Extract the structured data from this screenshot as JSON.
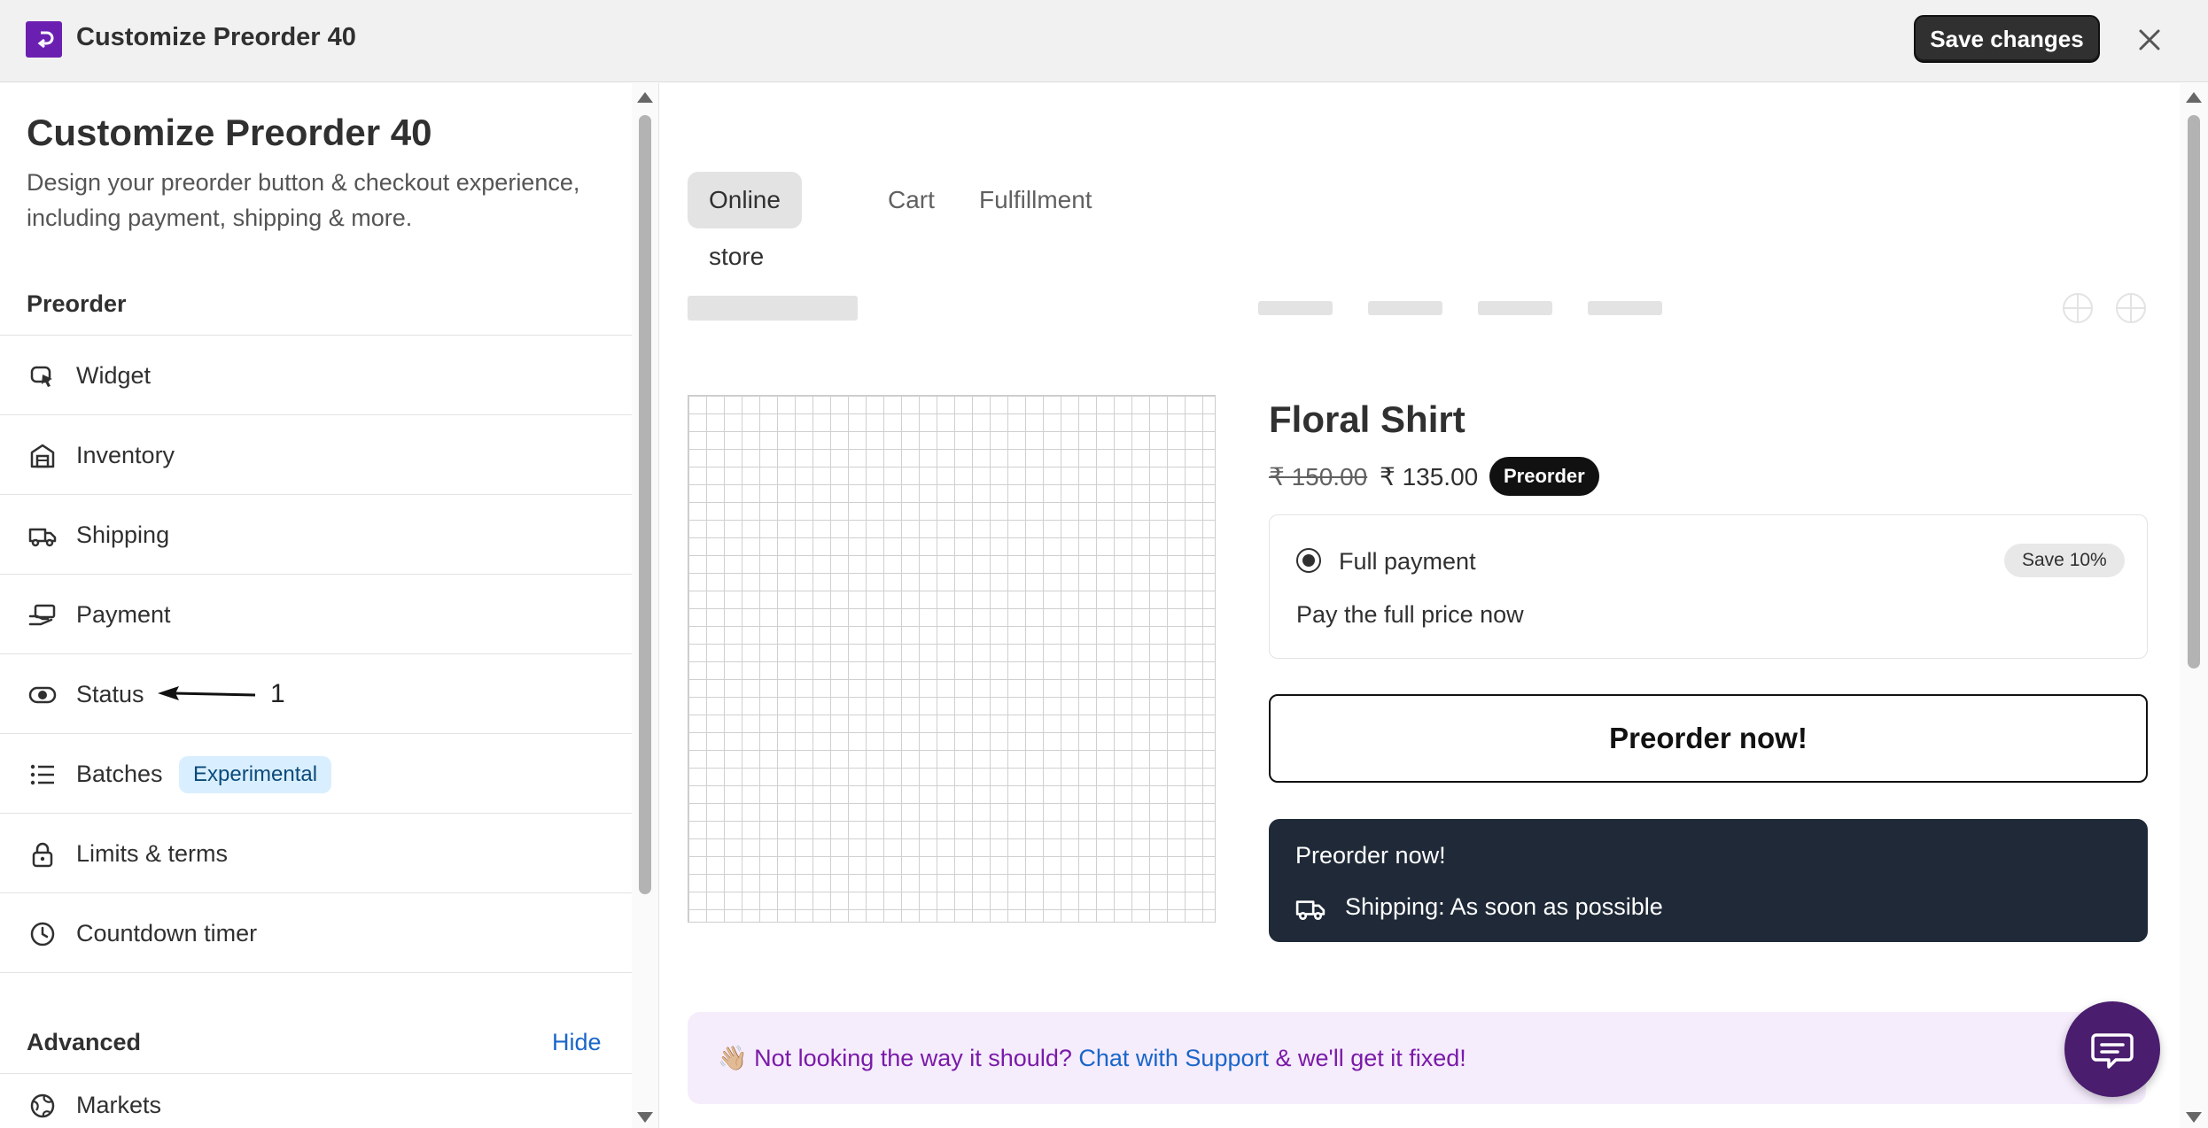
{
  "window": {
    "title": "Customize Preorder 40",
    "save_label": "Save changes",
    "logo_color": "#6b1fb1"
  },
  "sidebar": {
    "title": "Customize Preorder 40",
    "description": "Design your preorder button & checkout experience, including payment, shipping & more.",
    "section_preorder": "Preorder",
    "items": [
      {
        "label": "Widget",
        "icon": "cursor-select-icon"
      },
      {
        "label": "Inventory",
        "icon": "warehouse-icon"
      },
      {
        "label": "Shipping",
        "icon": "truck-icon"
      },
      {
        "label": "Payment",
        "icon": "hand-money-icon"
      },
      {
        "label": "Status",
        "icon": "toggle-icon",
        "annotation": "1"
      },
      {
        "label": "Batches",
        "icon": "list-icon",
        "badge": "Experimental"
      },
      {
        "label": "Limits & terms",
        "icon": "lock-icon"
      },
      {
        "label": "Countdown timer",
        "icon": "clock-icon"
      }
    ],
    "section_advanced": "Advanced",
    "hide_label": "Hide",
    "markets_label": "Markets"
  },
  "preview": {
    "tabs": [
      "Online store",
      "Cart",
      "Fulfillment"
    ],
    "active_tab": "Online store",
    "product": {
      "title": "Floral Shirt",
      "price_old": "₹ 150.00",
      "price_new": "₹ 135.00",
      "badge": "Preorder"
    },
    "payment_option": {
      "label": "Full payment",
      "save_badge": "Save 10%",
      "description": "Pay the full price now"
    },
    "preorder_button": "Preorder now!",
    "info_card": {
      "title": "Preorder now!",
      "shipping": "Shipping: As soon as possible"
    },
    "support": {
      "emoji": "👋🏼",
      "text_before": "Not looking the way it should?",
      "link": "Chat with Support",
      "text_after": "& we'll get it fixed!"
    }
  }
}
